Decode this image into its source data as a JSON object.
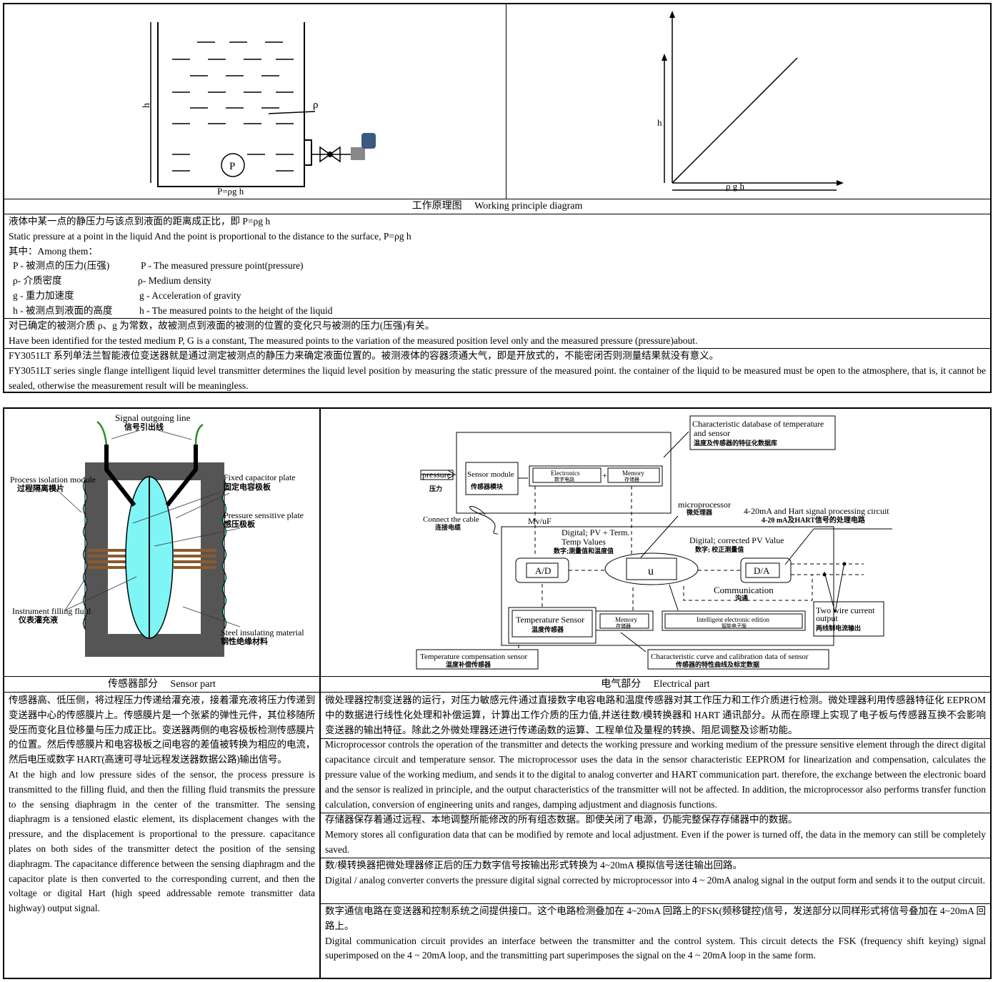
{
  "top": {
    "caption": "工作原理图　 Working principle diagram",
    "tank_labels": {
      "h": "h",
      "rho": "ρ",
      "P": "P",
      "formula": "P=ρg h"
    },
    "graph_labels": {
      "y": "h",
      "x": "ρ g h"
    },
    "para1": [
      "液体中某一点的静压力与该点到液面的距离成正比，即 P=ρg h",
      "Static pressure at a point in the liquid And the point is proportional to the distance to the surface, P=ρg h",
      "其中：Among them："
    ],
    "defs": [
      {
        "cn": "P - 被测点的压力(压强)",
        "en": "P - The measured pressure point(pressure)"
      },
      {
        "cn": "ρ- 介质密度",
        "en": "ρ- Medium density"
      },
      {
        "cn": "g - 重力加速度",
        "en": "g - Acceleration of gravity"
      },
      {
        "cn": "h - 被测点到液面的高度",
        "en": "h - The measured points to the height of the liquid"
      }
    ],
    "para2": [
      "对已确定的被测介质 ρ、g 为常数，故被测点到液面的被测的位置的变化只与被测的压力(压强)有关。",
      "Have been identified for the tested medium P, G is a constant, The measured points to the variation of the measured position level only and the measured pressure (pressure)about."
    ],
    "para3": [
      "FY3051LT 系列单法兰智能液位变送器就是通过测定被测点的静压力来确定液面位置的。被测液体的容器须通大气，即是开放式的，不能密闭否则测量结果就没有意义。",
      "FY3051LT series single flange intelligent liquid level transmitter determines the liquid level position by measuring the static pressure of the measured point. the container of the liquid to be measured must be open to the atmosphere, that is, it cannot be sealed, otherwise the measurement result will be meaningless."
    ]
  },
  "sensor": {
    "caption": "传感器部分　 Sensor part",
    "labels": {
      "signal_en": "Signal outgoing line",
      "signal_cn": "信号引出线",
      "iso_en": "Process isolation module",
      "iso_cn": "过程隔离模片",
      "fixed_en": "Fixed capacitor plate",
      "fixed_cn": "固定电容极板",
      "press_en": "Pressure sensitive plate",
      "press_cn": "感压极板",
      "fill_en": "Instrument filling fluid",
      "fill_cn": "仪表灌充液",
      "steel_en": "Steel insulating material",
      "steel_cn": "钢性绝缘材料"
    },
    "text_cn": "传感器高、低压侧，将过程压力传递给灌充液，接着灌充液将压力传递到变送器中心的传感膜片上。传感膜片是一个张紧的弹性元件，其位移随所受压而变化且位移量与压力成正比。变送器两侧的电容极板检测传感膜片的位置。然后传感膜片和电容极板之间电容的差值被转换为相应的电流，然后电压或数字 HART(高速可寻址远程发送器数据公路)输出信号。",
    "text_en": "At the high and low pressure sides of the sensor, the process pressure is transmitted to the filling fluid, and then the filling fluid transmits the pressure to the sensing diaphragm in the center of the transmitter. The sensing diaphragm is a tensioned elastic element, its displacement changes with the pressure, and the displacement is proportional to the pressure. capacitance plates on both sides of the transmitter detect the position of the sensing diaphragm. The capacitance difference between the sensing diaphragm and the capacitor plate is then converted to the corresponding current, and then the voltage or digital Hart (high speed addressable remote transmitter data highway) output signal."
  },
  "electrical": {
    "caption": "电气部分　 Electrical part",
    "labels": {
      "db_en1": "Characteristic database of temperature",
      "db_en2": "and sensor",
      "db_cn": "温度及传感器的特征化数据库",
      "pressure_en": "pressure",
      "pressure_cn": "压力",
      "sm_en": "Sensor module",
      "sm_cn": "传感器模块",
      "elec_en": "Electronics",
      "elec_cn": "数字电路",
      "mem_en": "Memory",
      "mem_cn": "存储器",
      "plus": "+",
      "cable_en": "Connect the cable",
      "cable_cn": "连接电缆",
      "mvuf": "Mv/uF",
      "dig1_en1": "Digital; PV + Term.",
      "dig1_en2": "Temp Values",
      "dig1_cn": "数字;测量值和温度值",
      "micro_en": "microprocessor",
      "micro_cn": "微处理器",
      "hart_en": "4-20mA and Hart signal processing circuit",
      "hart_cn": "4-20 mA及HART信号的处理电路",
      "dig2_en": "Digital; corrected PV Value",
      "dig2_cn": "数字; 校正测量值",
      "ad": "A/D",
      "u": "u",
      "da": "D/A",
      "comm_en": "Communication",
      "comm_cn": "沟通",
      "ts_en": "Temperature Sensor",
      "ts_cn": "温度传感器",
      "ie_en": "Intelligent electronic edition",
      "ie_cn": "智能电子版",
      "tw_en1": "Two wire current",
      "tw_en2": "output",
      "tw_cn": "两线制电流输出",
      "tc_en": "Temperature compensation sensor",
      "tc_cn": "温度补偿传感器",
      "cc_en": "Characteristic curve and calibration data of sensor",
      "cc_cn": "传感器的特性曲线及标定数据"
    },
    "sections": [
      [
        "微处理器控制变送器的运行，对压力敏感元件通过直接数字电容电路和温度传感器对其工作压力和工作介质进行检测。微处理器利用传感器特征化 EEPROM 中的数据进行线性化处理和补偿运算，计算出工作介质的压力值,并送往数/模转换器和 HART 通讯部分。从而在原理上实现了电子板与传感器互换不会影响变送器的输出特征。除此之外微处理器还进行传递函数的运算、工程单位及量程的转换、阻尼调整及诊断功能。",
        "Microprocessor controls the operation of the transmitter and detects the working pressure and working medium of the pressure sensitive element through the direct digital capacitance circuit and temperature sensor. The microprocessor uses the data in the sensor characteristic EEPROM for linearization and compensation, calculates the pressure value of the working medium, and sends it to the digital to analog converter and HART communication part. therefore, the exchange between the electronic board and the sensor is realized in principle, and the output characteristics of the transmitter will not be affected. In addition, the microprocessor also performs transfer function calculation, conversion of engineering units and ranges, damping adjustment and diagnosis functions."
      ],
      [
        "存储器保存着通过远程、本地调整所能修改的所有组态数据。即使关闭了电源，仍能完整保存存储器中的数据。",
        "Memory stores all configuration data that can be modified by remote and local adjustment. Even if the power is turned off, the data in the memory can still be completely saved."
      ],
      [
        "数/模转换器把微处理器修正后的压力数字信号按输出形式转换为 4~20mA 模拟信号送往输出回路。",
        "Digital / analog converter converts the pressure digital signal corrected by microprocessor into 4 ~ 20mA analog signal in the output form and sends it to the output circuit."
      ],
      [
        "数字通信电路在变送器和控制系统之间提供接口。这个电路检测叠加在 4~20mA 回路上的FSK(频移键控)信号，发送部分以同样形式将信号叠加在 4~20mA 回路上。",
        "Digital communication circuit provides an interface between the transmitter and the control system. This circuit detects the FSK (frequency shift keying) signal superimposed on the 4 ~ 20mA loop, and the transmitting part superimposes the signal on the 4 ~ 20mA loop in the same form."
      ]
    ]
  },
  "colors": {
    "fluid": "#7ff5f5",
    "body": "#555555",
    "wire": "#2e8b2e",
    "copper": "#8b5a2b"
  }
}
